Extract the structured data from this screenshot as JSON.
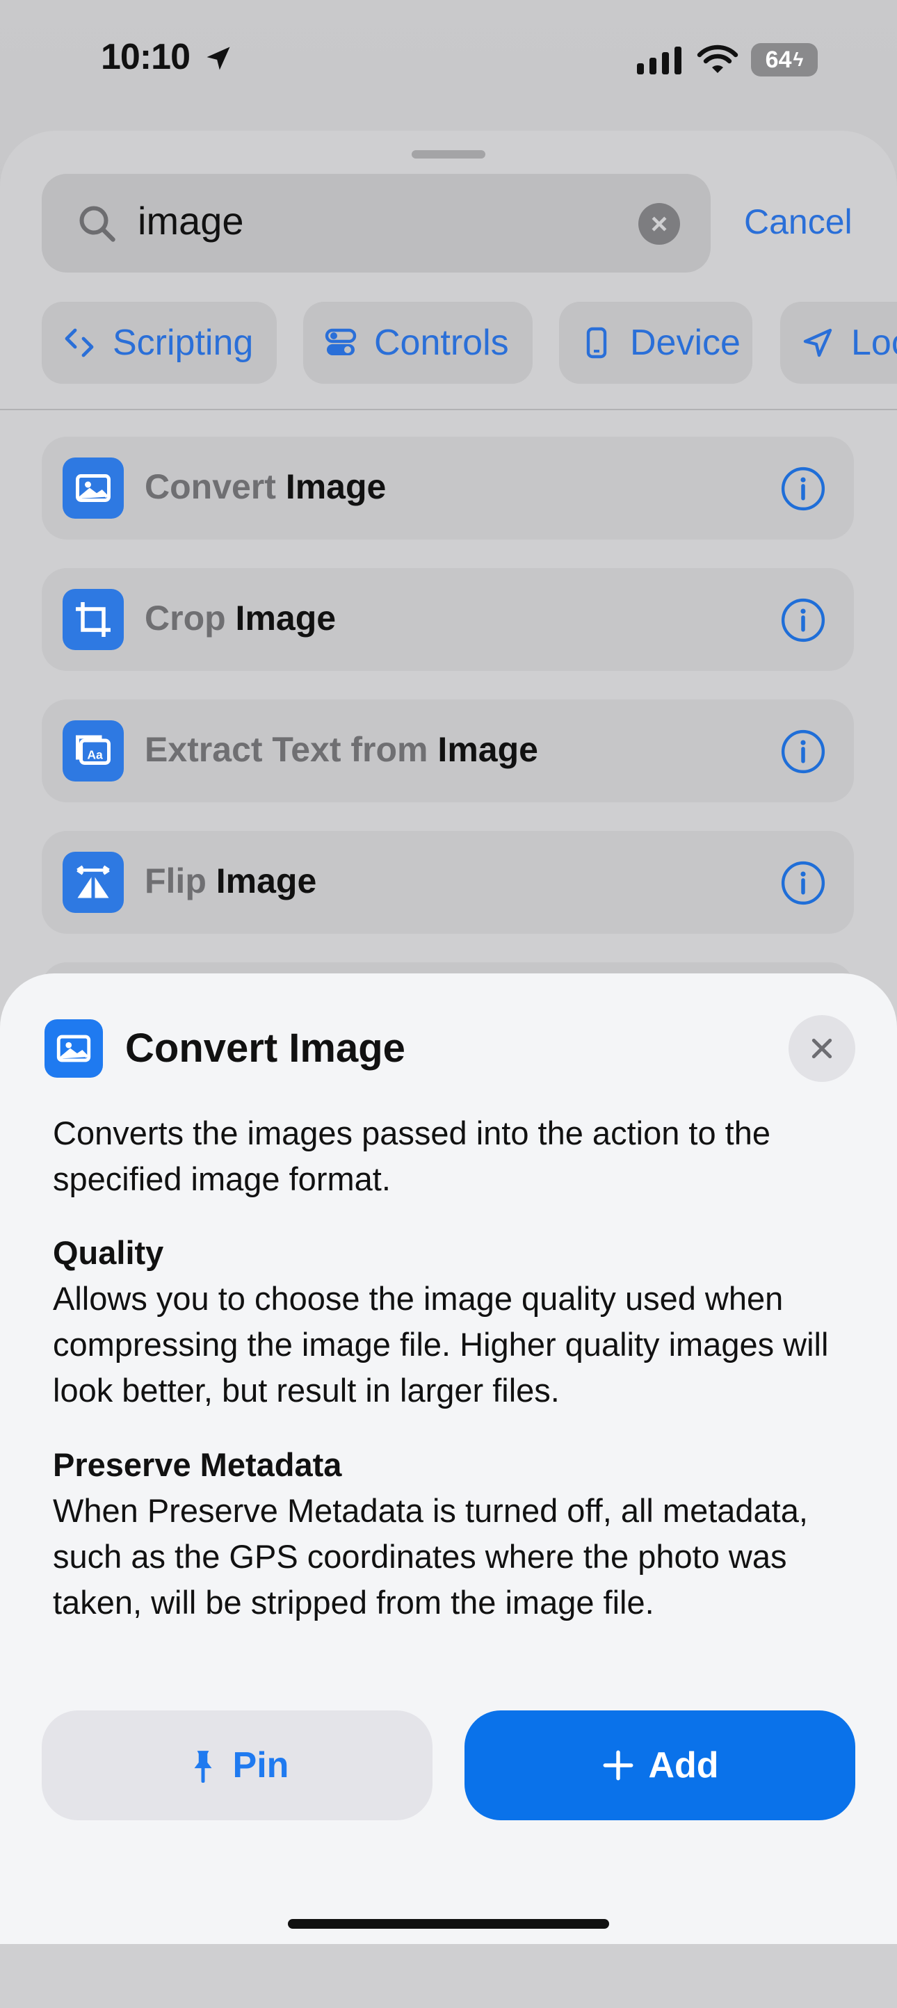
{
  "status_bar": {
    "time": "10:10",
    "battery": "64"
  },
  "search": {
    "query": "image",
    "cancel_label": "Cancel"
  },
  "chips": [
    {
      "label": "Scripting",
      "icon": "scripting-icon"
    },
    {
      "label": "Controls",
      "icon": "controls-icon"
    },
    {
      "label": "Device",
      "icon": "device-icon"
    },
    {
      "label": "Loc",
      "icon": "location-icon"
    }
  ],
  "results": [
    {
      "prefix": "Convert ",
      "match": "Image",
      "icon": "photo-icon"
    },
    {
      "prefix": "Crop ",
      "match": "Image",
      "icon": "crop-icon"
    },
    {
      "prefix": "Extract Text from ",
      "match": "Image",
      "icon": "text-recognition-icon"
    },
    {
      "prefix": "Flip ",
      "match": "Image",
      "icon": "flip-icon"
    }
  ],
  "detail": {
    "title": "Convert Image",
    "description": "Converts the images passed into the action to the specified image format.",
    "quality_heading": "Quality",
    "quality_text": "Allows you to choose the image quality used when compressing the image file. Higher quality images will look better, but result in larger files.",
    "metadata_heading": "Preserve Metadata",
    "metadata_text": "When Preserve Metadata is turned off, all metadata, such as the GPS coordinates where the photo was taken, will be stripped from the image file.",
    "pin_label": "Pin",
    "add_label": "Add"
  },
  "colors": {
    "accent": "#0a72ea",
    "link": "#2a6fd8",
    "card_background": "#f4f5f7"
  }
}
